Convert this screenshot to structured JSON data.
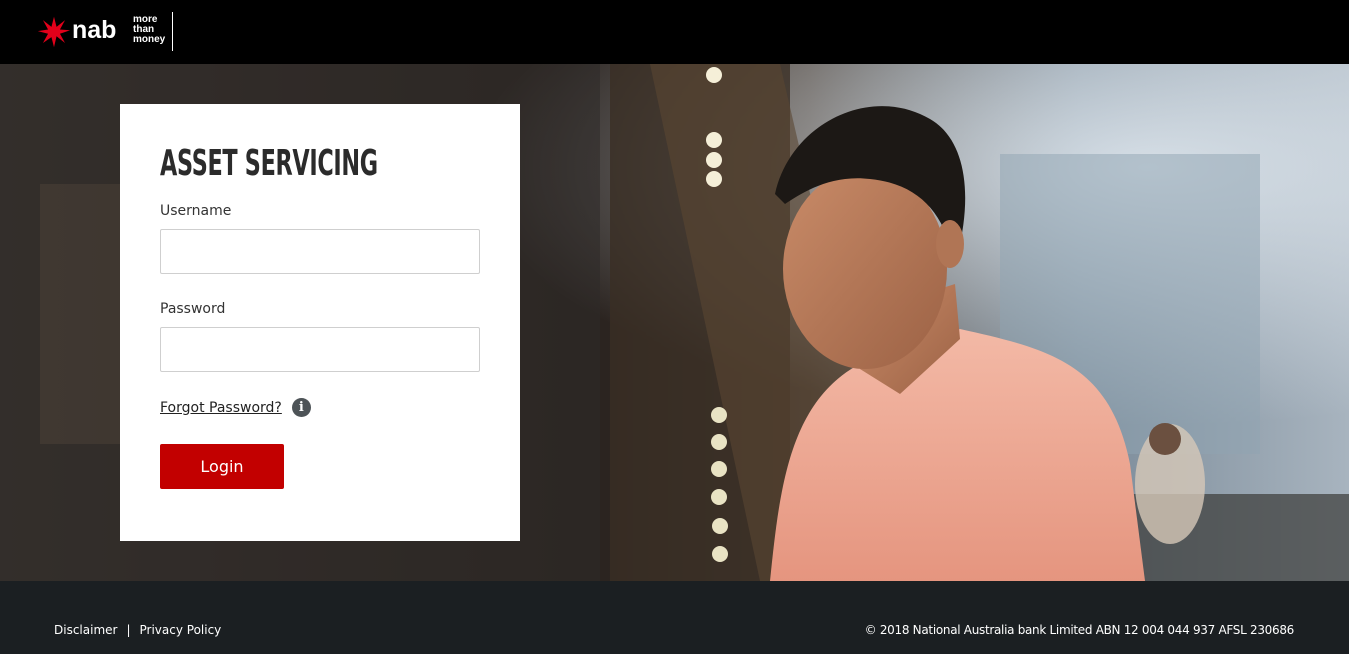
{
  "header": {
    "logo_text": "nab",
    "tagline": [
      "more",
      "than",
      "money"
    ]
  },
  "login": {
    "title": "ASSET SERVICING",
    "username_label": "Username",
    "username_value": "",
    "password_label": "Password",
    "password_value": "",
    "forgot_label": "Forgot Password?",
    "login_label": "Login"
  },
  "footer": {
    "disclaimer_label": "Disclaimer",
    "separator": "|",
    "privacy_label": "Privacy Policy",
    "copyright": "© 2018 National Australia bank Limited ABN 12 004 044 937 AFSL 230686"
  },
  "colors": {
    "brand_red": "#c20000",
    "header_bg": "#000000",
    "footer_bg": "#1b1f22"
  },
  "icons": {
    "logo": "nab-star-icon",
    "info": "info-icon"
  }
}
